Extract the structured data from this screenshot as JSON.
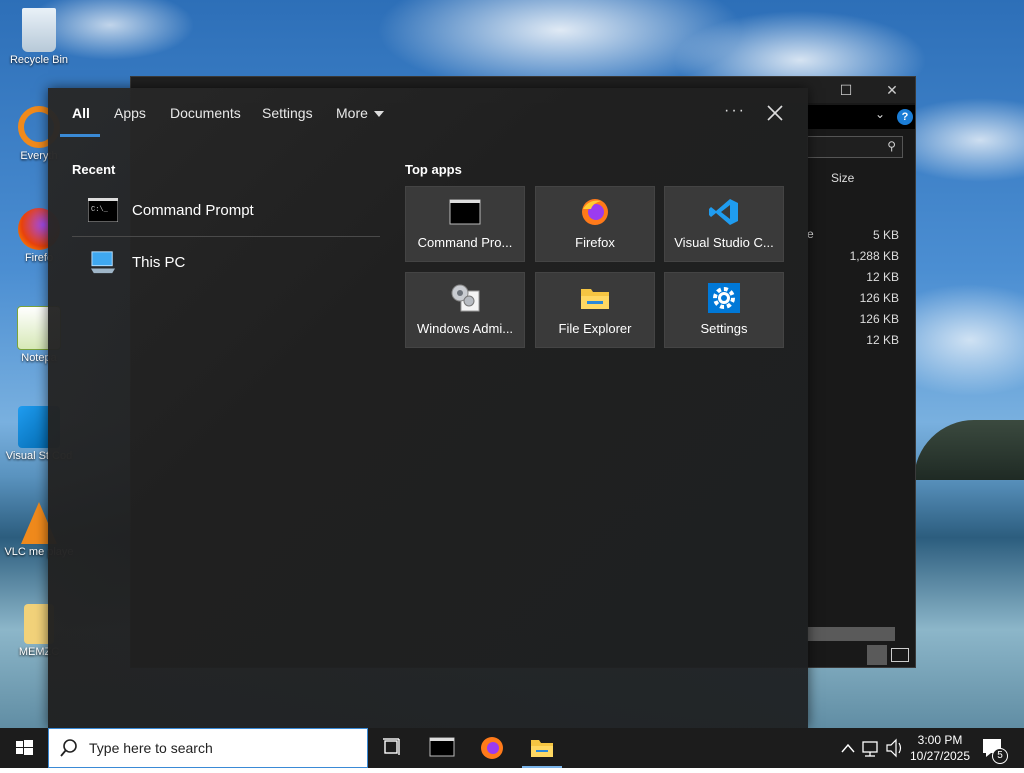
{
  "desktop": {
    "icons": [
      {
        "label": "Recycle Bin"
      },
      {
        "label": "Everyth"
      },
      {
        "label": "Firefo"
      },
      {
        "label": "Notepa"
      },
      {
        "label": "Visual St Cod"
      },
      {
        "label": "VLC me playe"
      },
      {
        "label": "MEMZC"
      }
    ]
  },
  "explorer": {
    "size_header": "Size",
    "sizes": [
      "5 KB",
      "1,288 KB",
      "12 KB",
      "126 KB",
      "126 KB",
      "12 KB"
    ],
    "partial_text": "e"
  },
  "search_panel": {
    "tabs": [
      {
        "label": "All",
        "active": true
      },
      {
        "label": "Apps"
      },
      {
        "label": "Documents"
      },
      {
        "label": "Settings"
      },
      {
        "label": "More"
      }
    ],
    "more_menu_glyph": "···",
    "recent": {
      "title": "Recent",
      "items": [
        {
          "label": "Command Prompt",
          "icon": "command-prompt-icon"
        },
        {
          "label": "This PC",
          "icon": "this-pc-icon"
        }
      ]
    },
    "top_apps": {
      "title": "Top apps",
      "items": [
        {
          "label": "Command Pro...",
          "icon": "command-prompt-icon"
        },
        {
          "label": "Firefox",
          "icon": "firefox-icon"
        },
        {
          "label": "Visual Studio C...",
          "icon": "vscode-icon"
        },
        {
          "label": "Windows Admi...",
          "icon": "admin-tools-icon"
        },
        {
          "label": "File Explorer",
          "icon": "file-explorer-icon"
        },
        {
          "label": "Settings",
          "icon": "settings-gear-icon"
        }
      ]
    }
  },
  "taskbar": {
    "search_placeholder": "Type here to search",
    "time": "3:00 PM",
    "date": "10/27/2025",
    "notification_count": "5"
  },
  "colors": {
    "accent": "#3a8ad6",
    "panel_bg": "#282828",
    "tile_bg": "#3a3a3a",
    "taskbar_bg": "#1c1c1c"
  }
}
